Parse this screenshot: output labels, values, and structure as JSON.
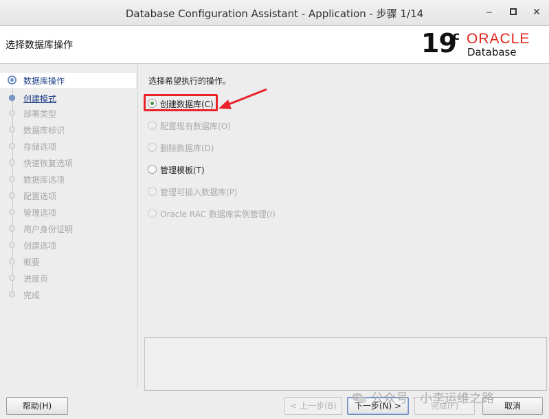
{
  "window": {
    "title": "Database Configuration Assistant - Application - 步骤 1/14",
    "minimize_glyph": "‒",
    "maximize_glyph": "▫",
    "close_glyph": "✕"
  },
  "header": {
    "step_title": "选择数据库操作",
    "logo": {
      "version": "19",
      "version_sup": "c",
      "brand": "ORACLE",
      "product": "Database",
      "brand_color": "#e3241b"
    }
  },
  "sidebar": {
    "items": [
      {
        "label": "数据库操作",
        "state": "current"
      },
      {
        "label": "创建模式",
        "state": "link"
      },
      {
        "label": "部署类型",
        "state": "disabled"
      },
      {
        "label": "数据库标识",
        "state": "disabled"
      },
      {
        "label": "存储选项",
        "state": "disabled"
      },
      {
        "label": "快速恢复选项",
        "state": "disabled"
      },
      {
        "label": "数据库选项",
        "state": "disabled"
      },
      {
        "label": "配置选项",
        "state": "disabled"
      },
      {
        "label": "管理选项",
        "state": "disabled"
      },
      {
        "label": "用户身份证明",
        "state": "disabled"
      },
      {
        "label": "创建选项",
        "state": "disabled"
      },
      {
        "label": "概要",
        "state": "disabled"
      },
      {
        "label": "进度页",
        "state": "disabled"
      },
      {
        "label": "完成",
        "state": "disabled"
      }
    ]
  },
  "main": {
    "prompt": "选择希望执行的操作。",
    "options": [
      {
        "label": "创建数据库(C)",
        "checked": true,
        "enabled": true
      },
      {
        "label": "配置现有数据库(O)",
        "checked": false,
        "enabled": false
      },
      {
        "label": "删除数据库(D)",
        "checked": false,
        "enabled": false
      },
      {
        "label": "管理模板(T)",
        "checked": false,
        "enabled": true
      },
      {
        "label": "管理可插入数据库(P)",
        "checked": false,
        "enabled": false
      },
      {
        "label": "Oracle RAC 数据库实例管理(I)",
        "checked": false,
        "enabled": false
      }
    ],
    "info_text": ""
  },
  "footer": {
    "help": "帮助(H)",
    "back": "< 上一步(B)",
    "next": "下一步(N) >",
    "finish": "完成(F)",
    "cancel": "取消"
  },
  "watermark": {
    "text": "公众号 · 小李运维之路"
  },
  "annotation": {
    "color": "#e8242a"
  }
}
